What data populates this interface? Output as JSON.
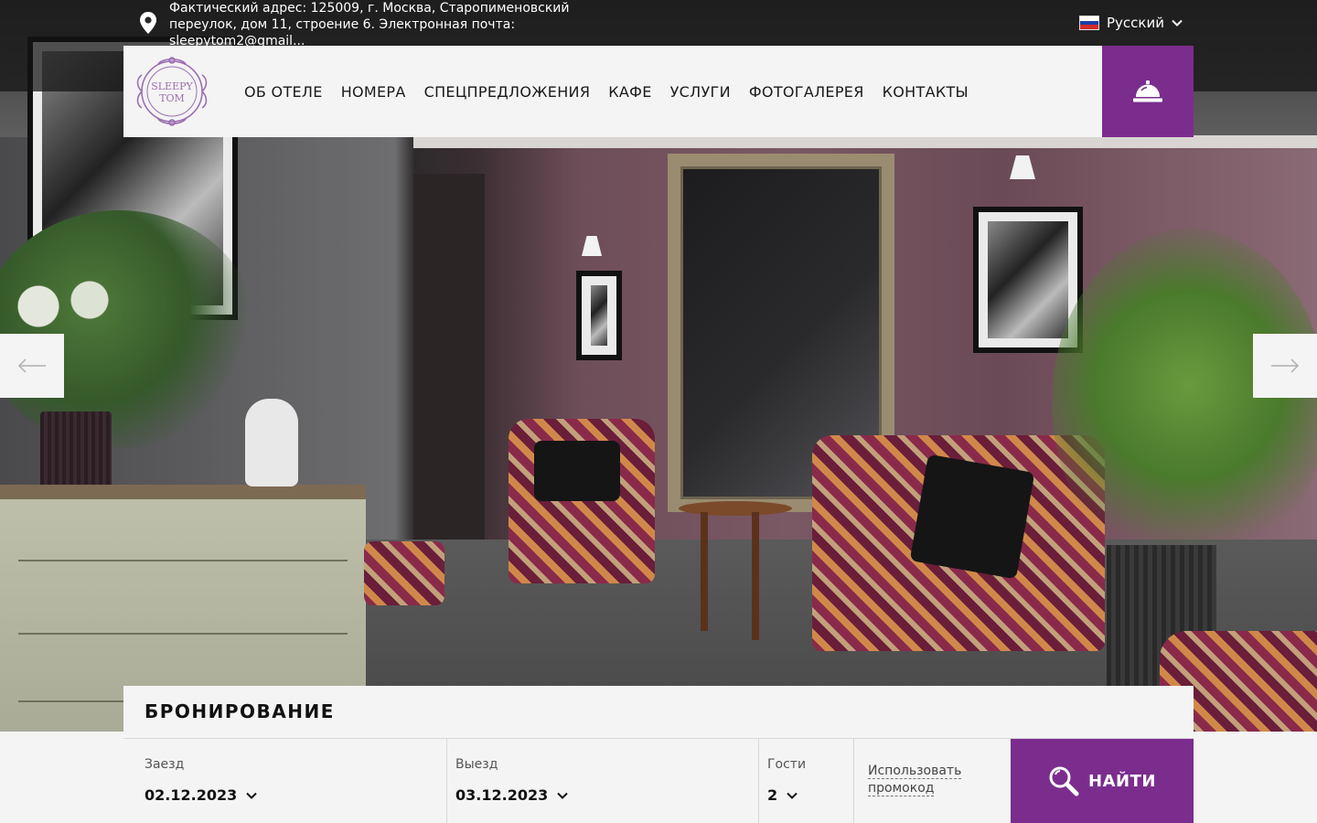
{
  "topbar": {
    "address": "Фактический адрес: 125009, г. Москва, Старопименовский переулок, дом 11, строение 6. Электронная почта: sleepytom2@gmail...",
    "language": "Русский"
  },
  "logo": {
    "line1": "SLEEPY",
    "line2": "TOM"
  },
  "nav": {
    "items": [
      {
        "label": "ОБ ОТЕЛЕ"
      },
      {
        "label": "НОМЕРА"
      },
      {
        "label": "СПЕЦПРЕДЛОЖЕНИЯ"
      },
      {
        "label": "КАФЕ"
      },
      {
        "label": "УСЛУГИ"
      },
      {
        "label": "ФОТОГАЛЕРЕЯ"
      },
      {
        "label": "КОНТАКТЫ"
      }
    ]
  },
  "booking": {
    "title": "БРОНИРОВАНИЕ",
    "checkin": {
      "label": "Заезд",
      "value": "02.12.2023"
    },
    "checkout": {
      "label": "Выезд",
      "value": "03.12.2023"
    },
    "guests": {
      "label": "Гости",
      "value": "2"
    },
    "promo": "Использовать промокод",
    "search": "НАЙТИ"
  },
  "colors": {
    "accent": "#7b2d8e",
    "panel": "#f4f4f4",
    "topbar": "rgba(20,20,20,0.72)"
  },
  "icons": [
    "map-pin-icon",
    "russian-flag-icon",
    "chevron-down-icon",
    "reception-bell-icon",
    "arrow-left-icon",
    "arrow-right-icon",
    "search-icon"
  ]
}
